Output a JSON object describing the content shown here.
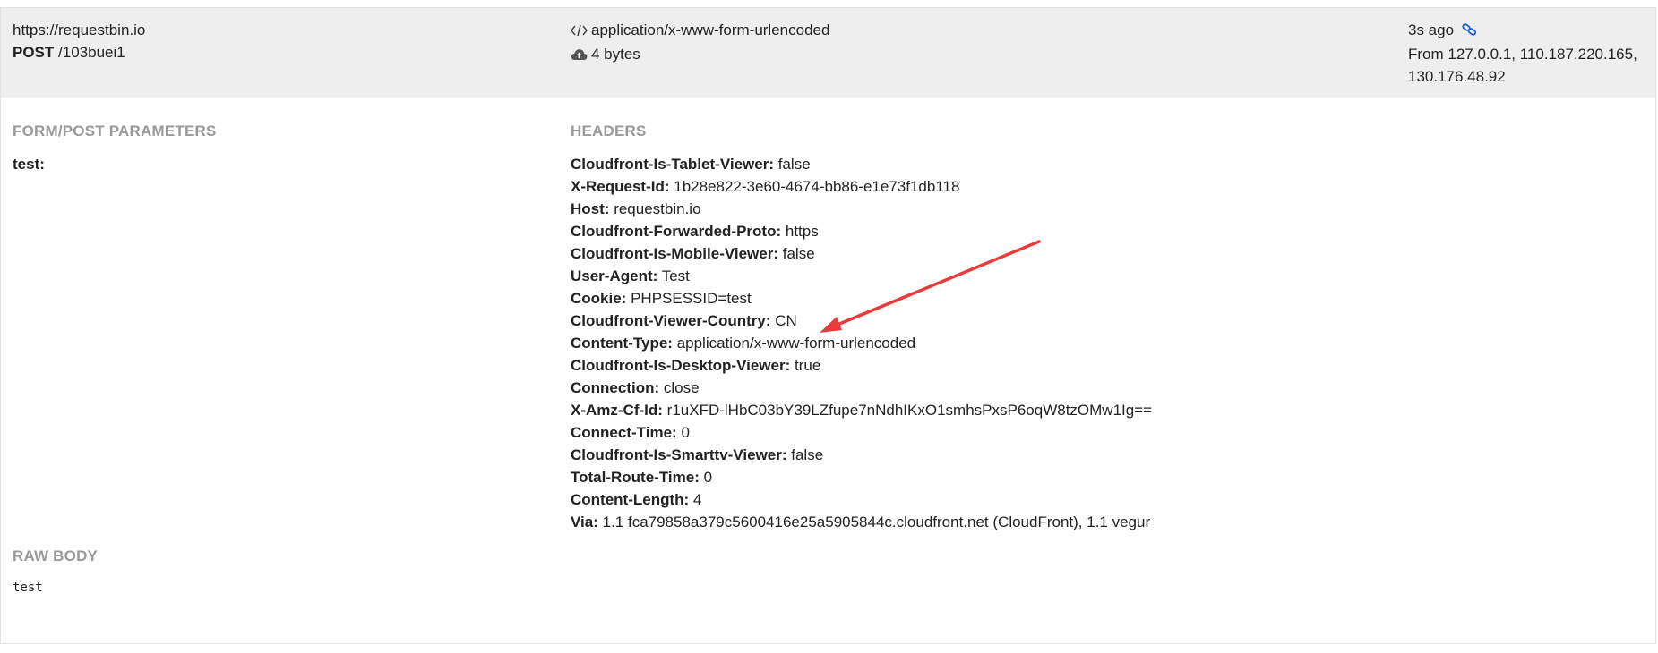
{
  "request": {
    "base_url": "https://requestbin.io",
    "method": "POST",
    "path": "/103buei1",
    "content_type": "application/x-www-form-urlencoded",
    "size": "4 bytes",
    "time_ago": "3s ago",
    "from_line1": "From 127.0.0.1, 110.187.220.165,",
    "from_line2": "130.176.48.92"
  },
  "icons": {
    "content_type": "code-icon",
    "size": "cloud-upload-icon",
    "permalink": "link-icon",
    "link_color": "#1a5fd6",
    "arrow_color": "#e83b3b"
  },
  "form": {
    "title": "FORM/POST PARAMETERS",
    "params": [
      {
        "key": "test:",
        "value": ""
      }
    ]
  },
  "headers": {
    "title": "HEADERS",
    "items": [
      {
        "key": "Cloudfront-Is-Tablet-Viewer:",
        "value": "false"
      },
      {
        "key": "X-Request-Id:",
        "value": "1b28e822-3e60-4674-bb86-e1e73f1db118"
      },
      {
        "key": "Host:",
        "value": "requestbin.io"
      },
      {
        "key": "Cloudfront-Forwarded-Proto:",
        "value": "https"
      },
      {
        "key": "Cloudfront-Is-Mobile-Viewer:",
        "value": "false"
      },
      {
        "key": "User-Agent:",
        "value": "Test"
      },
      {
        "key": "Cookie:",
        "value": "PHPSESSID=test"
      },
      {
        "key": "Cloudfront-Viewer-Country:",
        "value": "CN"
      },
      {
        "key": "Content-Type:",
        "value": "application/x-www-form-urlencoded"
      },
      {
        "key": "Cloudfront-Is-Desktop-Viewer:",
        "value": "true"
      },
      {
        "key": "Connection:",
        "value": "close"
      },
      {
        "key": "X-Amz-Cf-Id:",
        "value": "r1uXFD-lHbC03bY39LZfupe7nNdhIKxO1smhsPxsP6oqW8tzOMw1Ig=="
      },
      {
        "key": "Connect-Time:",
        "value": "0"
      },
      {
        "key": "Cloudfront-Is-Smarttv-Viewer:",
        "value": "false"
      },
      {
        "key": "Total-Route-Time:",
        "value": "0"
      },
      {
        "key": "Content-Length:",
        "value": "4"
      },
      {
        "key": "Via:",
        "value": "1.1 fca79858a379c5600416e25a5905844c.cloudfront.net (CloudFront), 1.1 vegur"
      }
    ]
  },
  "raw_body": {
    "title": "RAW BODY",
    "content": "test"
  }
}
